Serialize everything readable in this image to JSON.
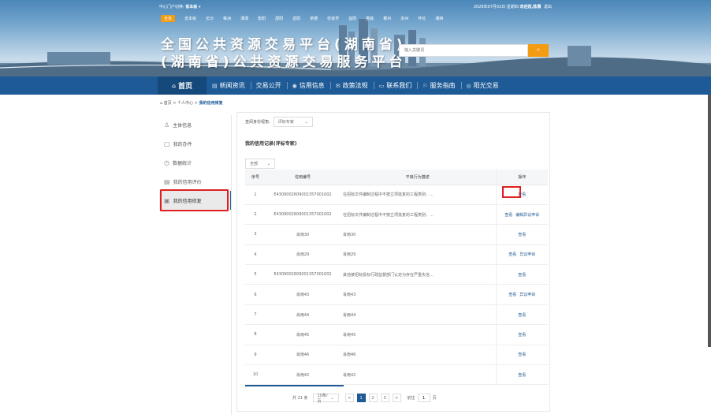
{
  "header": {
    "portal_label": "中心门户切换:",
    "portal_value": "省本级 ▾",
    "date_text": "2026年07月02日 星期四",
    "welcome": "欢迎您,",
    "user": "陈晨",
    "logout": "退出",
    "cities": [
      "全省",
      "省本级",
      "长沙",
      "株洲",
      "湘潭",
      "衡阳",
      "邵阳",
      "岳阳",
      "常德",
      "张家界",
      "益阳",
      "娄底",
      "郴州",
      "永州",
      "怀化",
      "湘西"
    ],
    "title_line1": "全国公共资源交易平台(湖南省)",
    "title_line2": "(湖南省)公共资源交易服务平台",
    "search_placeholder": "输入关键词",
    "search_icon": "search-icon"
  },
  "nav": [
    {
      "label": "首页",
      "icon": "home-icon",
      "glyph": "⌂"
    },
    {
      "label": "新闻资讯",
      "icon": "news-icon",
      "glyph": "▤"
    },
    {
      "label": "交易公开",
      "icon": "",
      "glyph": ""
    },
    {
      "label": "信用信息",
      "icon": "credit-icon",
      "glyph": "◉"
    },
    {
      "label": "政策法规",
      "icon": "policy-icon",
      "glyph": "✉"
    },
    {
      "label": "联系我们",
      "icon": "contact-icon",
      "glyph": "▭"
    },
    {
      "label": "服务指南",
      "icon": "guide-icon",
      "glyph": "⚐"
    },
    {
      "label": "阳光交易",
      "icon": "sun-icon",
      "glyph": "◎"
    }
  ],
  "breadcrumb": {
    "home": "首页",
    "sep": " > ",
    "mid": "个人中心",
    "current": "我的信用修复"
  },
  "sidebar": [
    {
      "label": "主体信息",
      "icon": "user-icon",
      "glyph": "♙"
    },
    {
      "label": "我的办件",
      "icon": "briefcase-icon",
      "glyph": "▢"
    },
    {
      "label": "数据统计",
      "icon": "clock-icon",
      "glyph": "◷"
    },
    {
      "label": "我的信用评价",
      "icon": "credit-card-icon",
      "glyph": "▤"
    },
    {
      "label": "我的信用修复",
      "icon": "repair-icon",
      "glyph": "▣",
      "active": true
    }
  ],
  "main": {
    "role_label": "查阅身份视角:",
    "role_value": "评标专家",
    "records_title": "我的信用记录(评标专家)",
    "filter_value": "全部",
    "columns": [
      "序号",
      "信用编号",
      "不良行为描述",
      "操作"
    ],
    "rows": [
      {
        "no": "1",
        "code": "E4309002609001357001002",
        "desc": "在招标文件编制过程中不按立项批复的工程类别、...",
        "actions": [
          "查看"
        ]
      },
      {
        "no": "2",
        "code": "E4309002609001357001002",
        "desc": "在招标文件编制过程中不按立项批复的工程类别、...",
        "actions": [
          "查看",
          "编辑异议申诉"
        ]
      },
      {
        "no": "3",
        "code": "肖雨30",
        "desc": "肖雨30",
        "actions": [
          "查看"
        ]
      },
      {
        "no": "4",
        "code": "肖雨29",
        "desc": "肖雨29",
        "actions": [
          "查看",
          "异议申诉"
        ]
      },
      {
        "no": "5",
        "code": "E4309002609001357001002",
        "desc": "其他被招标投标行政监督部门认定为存在严重失信...",
        "actions": [
          "查看"
        ]
      },
      {
        "no": "6",
        "code": "肖雨43",
        "desc": "肖雨43",
        "actions": [
          "查看",
          "异议申诉"
        ]
      },
      {
        "no": "7",
        "code": "肖雨44",
        "desc": "肖雨44",
        "actions": [
          "查看"
        ]
      },
      {
        "no": "8",
        "code": "肖雨45",
        "desc": "肖雨45",
        "actions": [
          "查看"
        ]
      },
      {
        "no": "9",
        "code": "肖雨46",
        "desc": "肖雨46",
        "actions": [
          "查看"
        ]
      },
      {
        "no": "10",
        "code": "肖雨42",
        "desc": "肖雨42",
        "actions": [
          "查看"
        ]
      }
    ],
    "pager": {
      "total": "共 21 条",
      "page_size": "10条/页",
      "prev": "<",
      "pages": [
        "1",
        "2",
        "3"
      ],
      "current": "1",
      "next": ">",
      "goto_label": "前往",
      "goto_value": "1",
      "goto_suffix": "页"
    }
  },
  "colors": {
    "primary": "#1e5a96",
    "accent": "#f39c12",
    "highlight": "#e02020"
  }
}
